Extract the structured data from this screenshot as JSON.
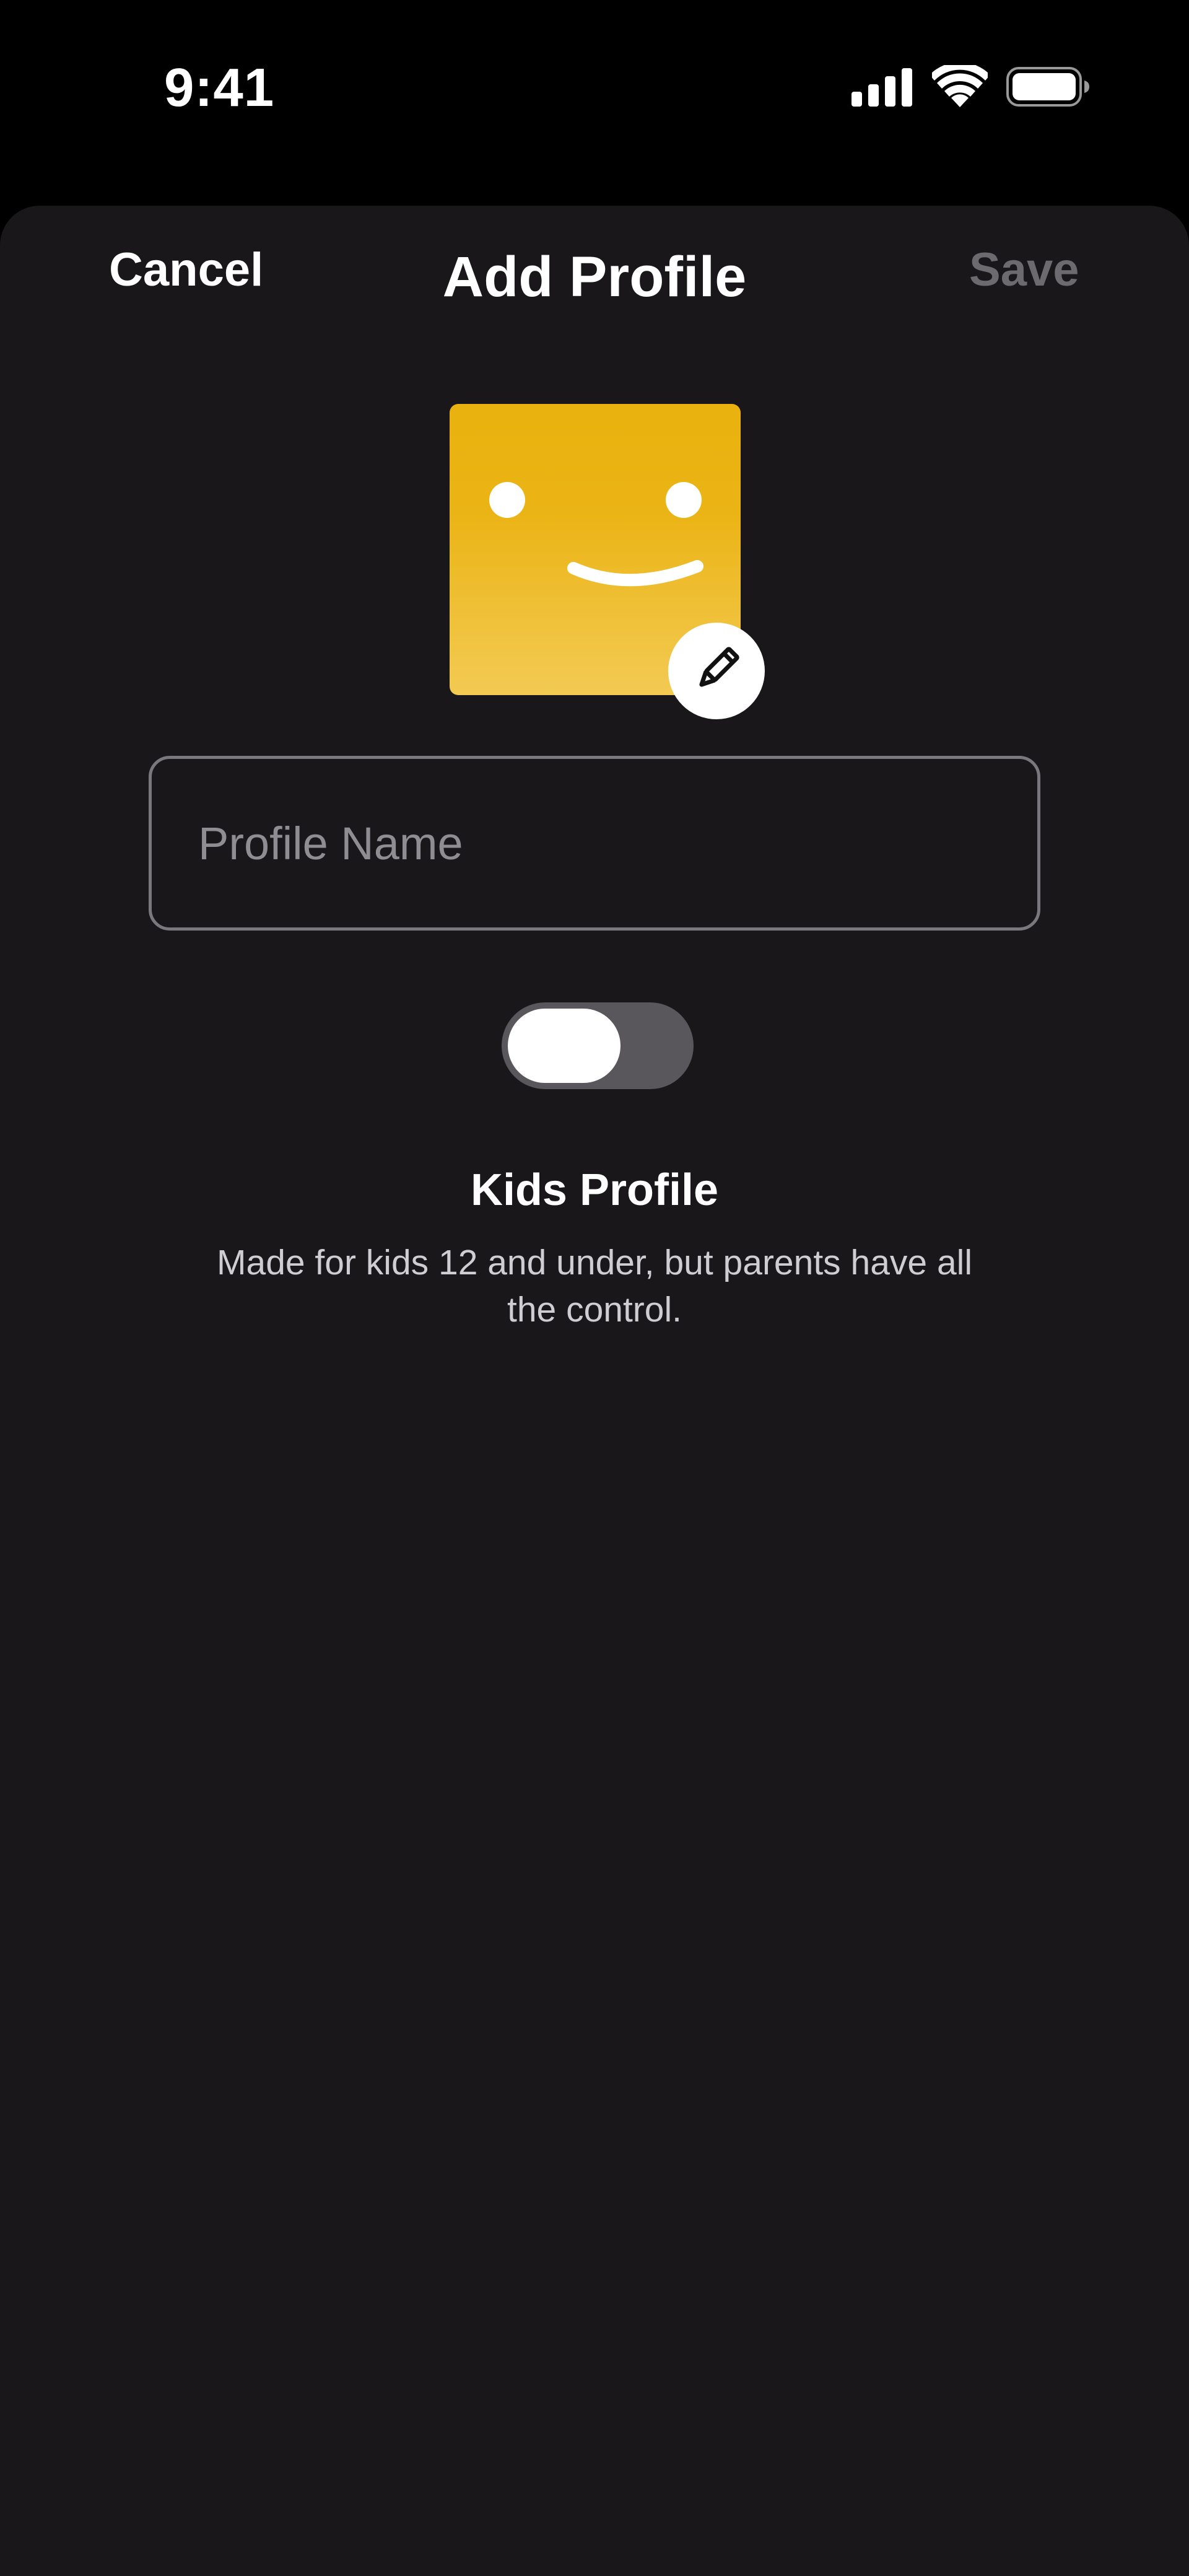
{
  "status_bar": {
    "time": "9:41",
    "icons": [
      "signal-icon",
      "wifi-icon",
      "battery-icon"
    ]
  },
  "header": {
    "cancel_label": "Cancel",
    "title": "Add Profile",
    "save_label": "Save"
  },
  "avatar": {
    "icon": "smiley-face-icon",
    "edit_icon": "pencil-icon",
    "color": "#EBB416"
  },
  "form": {
    "profile_name_placeholder": "Profile Name",
    "profile_name_value": ""
  },
  "kids_profile": {
    "toggle_on": false,
    "title": "Kids Profile",
    "description": "Made for kids 12 and under, but parents have all the control."
  },
  "colors": {
    "background": "#19171A",
    "status_bar": "#000000",
    "save_disabled": "#6C6A6F",
    "toggle_track": "#59575C"
  }
}
